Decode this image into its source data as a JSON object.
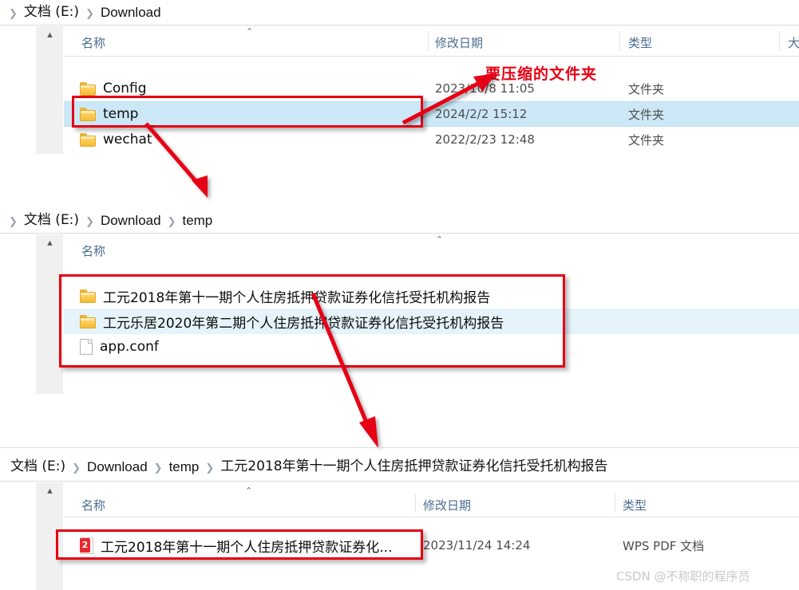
{
  "colors": {
    "annotation": "#e60012",
    "selection": "#cce8f7",
    "hover": "#e5f3fb",
    "header_text": "#4a6c8f",
    "watermark": "#c9c9c9"
  },
  "panels": [
    {
      "id": "panel-download",
      "breadcrumb": [
        "文档 (E:)",
        "Download"
      ],
      "columns": [
        {
          "key": "name",
          "label": "名称",
          "sorted": true
        },
        {
          "key": "date",
          "label": "修改日期"
        },
        {
          "key": "type",
          "label": "类型"
        },
        {
          "key": "size",
          "label": "大"
        }
      ],
      "rows": [
        {
          "icon": "folder-icon",
          "name": "Config",
          "date": "2023/10/8 11:05",
          "type": "文件夹",
          "state": "normal"
        },
        {
          "icon": "folder-icon",
          "name": "temp",
          "date": "2024/2/2 15:12",
          "type": "文件夹",
          "state": "selected"
        },
        {
          "icon": "folder-icon",
          "name": "wechat",
          "date": "2022/2/23 12:48",
          "type": "文件夹",
          "state": "normal"
        }
      ]
    },
    {
      "id": "panel-temp",
      "breadcrumb": [
        "文档 (E:)",
        "Download",
        "temp"
      ],
      "columns": [
        {
          "key": "name",
          "label": "名称",
          "sorted": true
        }
      ],
      "rows": [
        {
          "icon": "folder-icon",
          "name": "工元2018年第十一期个人住房抵押贷款证券化信托受托机构报告",
          "state": "normal"
        },
        {
          "icon": "folder-icon",
          "name": "工元乐居2020年第二期个人住房抵押贷款证券化信托受托机构报告",
          "state": "hover"
        },
        {
          "icon": "file-icon",
          "name": "app.conf",
          "state": "normal"
        }
      ]
    },
    {
      "id": "panel-report",
      "breadcrumb": [
        "文档 (E:)",
        "Download",
        "temp",
        "工元2018年第十一期个人住房抵押贷款证券化信托受托机构报告"
      ],
      "columns": [
        {
          "key": "name",
          "label": "名称",
          "sorted": true
        },
        {
          "key": "date",
          "label": "修改日期"
        },
        {
          "key": "type",
          "label": "类型"
        }
      ],
      "rows": [
        {
          "icon": "pdf-icon",
          "name": "工元2018年第十一期个人住房抵押贷款证券化...",
          "date": "2023/11/24 14:24",
          "type": "WPS PDF 文档",
          "state": "normal"
        }
      ]
    }
  ],
  "annotations": {
    "callout_label": "要压缩的文件夹",
    "pdf_badge_glyph": "2"
  },
  "watermark": "CSDN @不称职的程序员",
  "breadcrumb_separator": "❯"
}
